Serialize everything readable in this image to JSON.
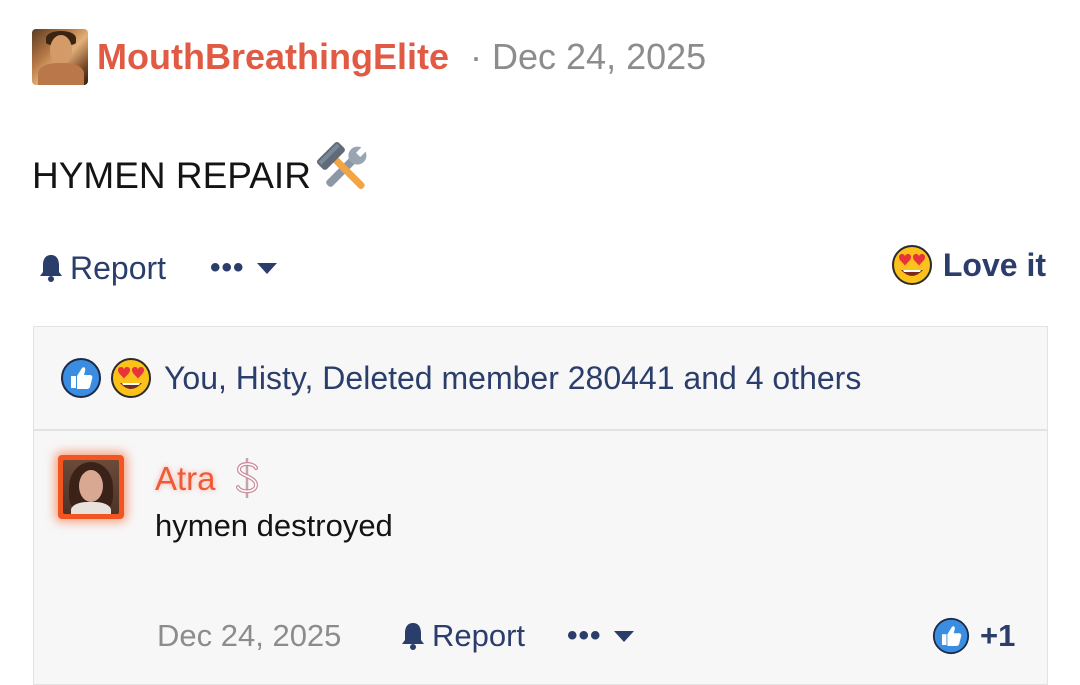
{
  "post": {
    "author": "MouthBreathingElite",
    "date_sep": "·",
    "date": "Dec 24, 2025",
    "body": "HYMEN REPAIR",
    "body_icon": "hammer-and-wrench-icon"
  },
  "actions": {
    "report_label": "Report",
    "more_label": "•••",
    "love_label": "Love it"
  },
  "reactions": {
    "summary": "You, Histy, Deleted member 280441 and 4 others",
    "icons": [
      "thumbs-up-icon",
      "heart-eyes-icon"
    ]
  },
  "comment": {
    "author": "Atra",
    "badge_icon": "dollar-icon",
    "body": "hymen destroyed",
    "date": "Dec 24, 2025",
    "report_label": "Report",
    "more_label": "•••",
    "like_count": "+1"
  },
  "colors": {
    "username": "#e05a44",
    "comment_username": "#f05a35",
    "action": "#2b3e6b",
    "muted": "#8c8c8c",
    "panel_bg": "#f7f7f8"
  }
}
